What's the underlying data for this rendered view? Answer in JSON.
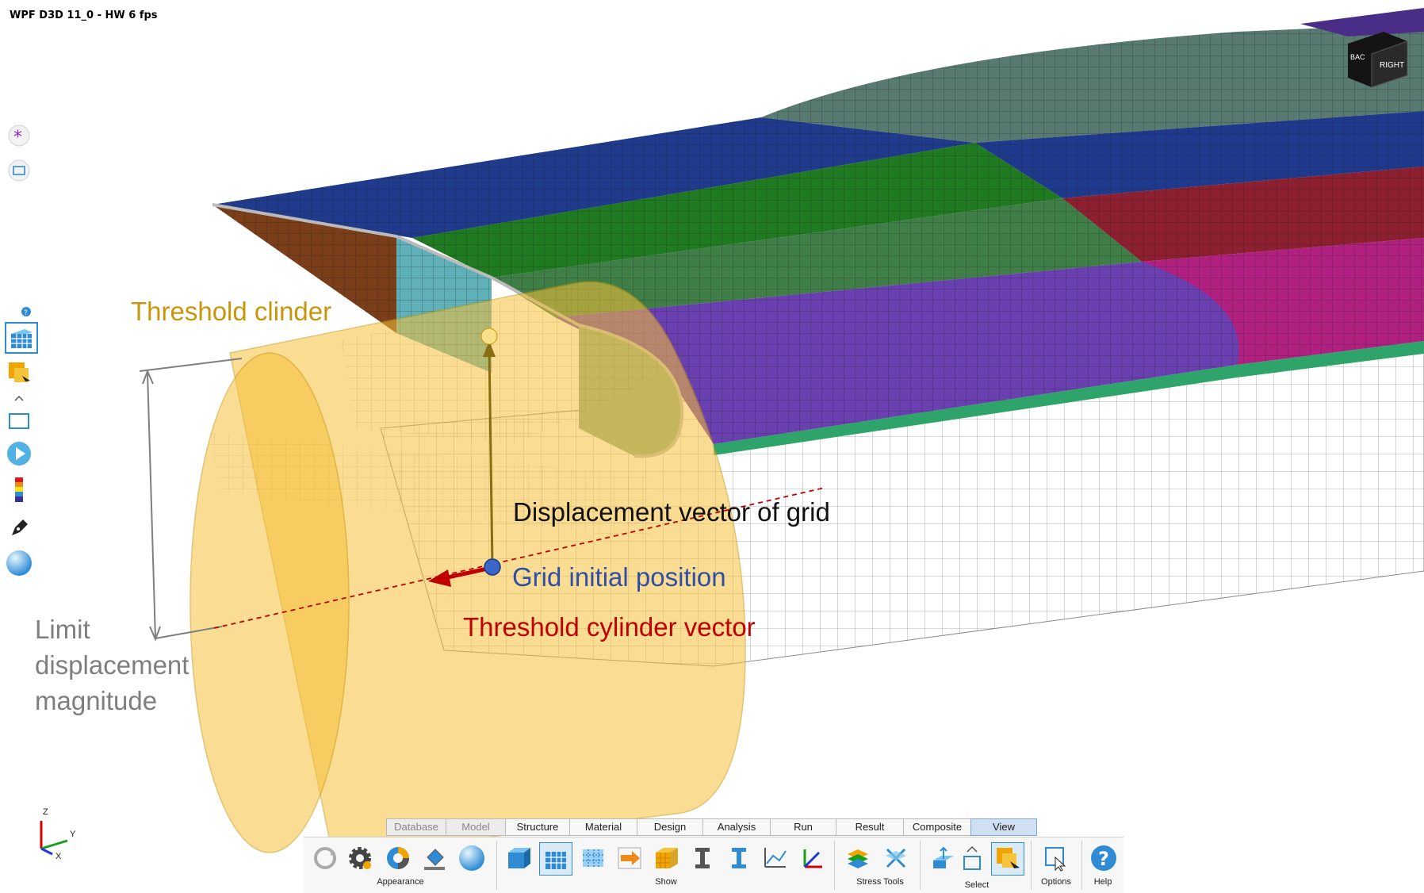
{
  "window": {
    "title": "WPF D3D 11_0 - HW   6 fps"
  },
  "view_cube": {
    "face_label": "RIGHT",
    "side_label": "BAC"
  },
  "annotations": {
    "threshold_cylinder": "Threshold clinder",
    "displacement_vector": "Displacement vector of grid",
    "grid_initial_position": "Grid initial position",
    "threshold_cylinder_vector": "Threshold cylinder vector",
    "limit_line1": "Limit",
    "limit_line2": "displacement",
    "limit_line3": "magnitude"
  },
  "annotation_colors": {
    "threshold_cylinder": "#c8960a",
    "displacement_vector": "#111111",
    "grid_initial_position": "#2f4fa5",
    "threshold_cylinder_vector": "#c00000",
    "limit": "#7f7f7f"
  },
  "ribbon": {
    "tabs": [
      {
        "label": "Database",
        "state": "disabled"
      },
      {
        "label": "Model",
        "state": "disabled"
      },
      {
        "label": "Structure",
        "state": "normal"
      },
      {
        "label": "Material",
        "state": "normal"
      },
      {
        "label": "Design",
        "state": "normal"
      },
      {
        "label": "Analysis",
        "state": "normal"
      },
      {
        "label": "Run",
        "state": "normal"
      },
      {
        "label": "Result",
        "state": "normal"
      },
      {
        "label": "Composite",
        "state": "normal"
      },
      {
        "label": "View",
        "state": "active"
      }
    ],
    "groups": {
      "appearance": "Appearance",
      "show": "Show",
      "stress_tools": "Stress Tools",
      "select": "Select",
      "options": "Options",
      "help": "Help"
    }
  },
  "triad": {
    "z": "Z",
    "y": "Y",
    "x": "X"
  },
  "icons": [
    "asterisk-icon",
    "rectangle-icon",
    "help-badge-icon",
    "mesh-view-icon",
    "select-element-icon",
    "collapse-chevron-icon",
    "play-icon",
    "contour-legend-icon",
    "pen-icon",
    "sphere-icon"
  ]
}
